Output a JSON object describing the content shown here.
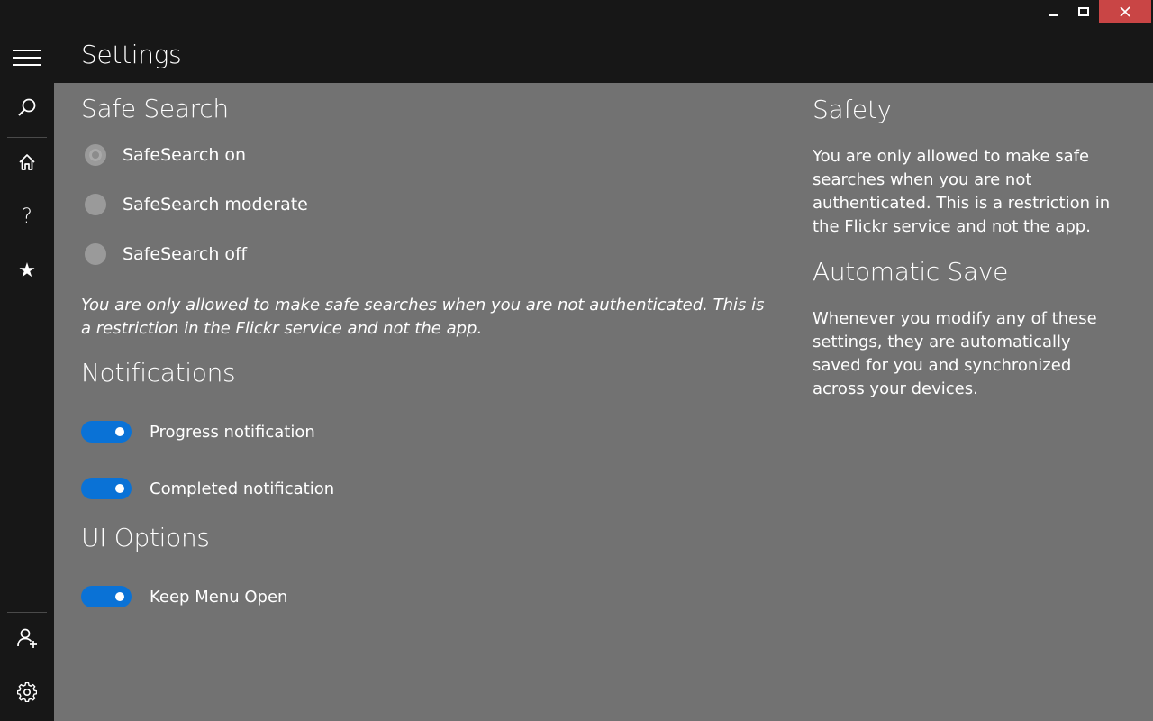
{
  "window": {
    "minimize_glyph": "–",
    "maximize_glyph": "□",
    "close_glyph": "✕",
    "close_color": "#c94545"
  },
  "header": {
    "title": "Settings"
  },
  "rail": {
    "top_items": [
      "hamburger-icon",
      "search-icon",
      "home-icon",
      "help-icon",
      "favorites-icon"
    ],
    "bottom_items": [
      "add-user-icon",
      "settings-gear-icon"
    ],
    "help_glyph": "?",
    "star_glyph": "★"
  },
  "safe_search": {
    "heading": "Safe Search",
    "options": [
      {
        "label": "SafeSearch on",
        "checked": true
      },
      {
        "label": "SafeSearch moderate",
        "checked": false
      },
      {
        "label": "SafeSearch off",
        "checked": false
      }
    ],
    "note": "You are only allowed to make safe searches when you are not authenticated. This is a restriction in the Flickr service and not the app."
  },
  "notifications": {
    "heading": "Notifications",
    "toggles": [
      {
        "label": "Progress notification",
        "on": true
      },
      {
        "label": "Completed notification",
        "on": true
      }
    ]
  },
  "ui_options": {
    "heading": "UI Options",
    "toggles": [
      {
        "label": "Keep Menu Open",
        "on": true
      }
    ]
  },
  "sidebar_info": {
    "safety_heading": "Safety",
    "safety_text": "You are only allowed to make safe searches when you are not authenticated. This is a restriction in the Flickr service and not the app.",
    "autosave_heading": "Automatic Save",
    "autosave_text": "Whenever you modify any of these settings, they are automatically saved for you and synchronized across your devices."
  },
  "colors": {
    "accent": "#0a72d6",
    "content_bg": "#727272",
    "chrome_bg": "#171717"
  }
}
